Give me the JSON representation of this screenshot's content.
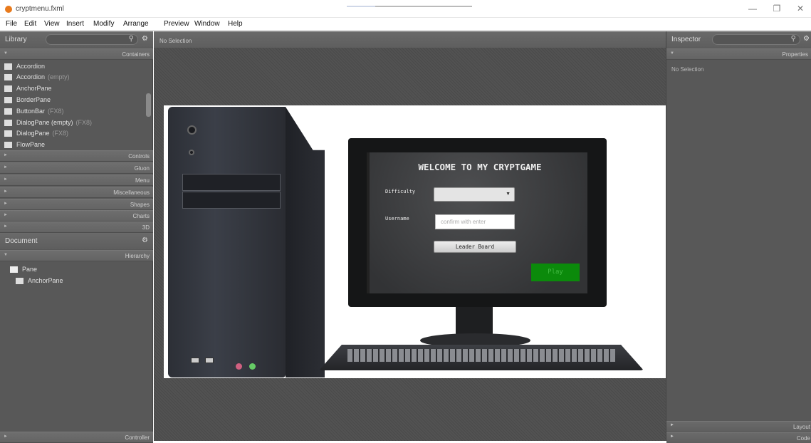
{
  "window": {
    "title": "cryptmenu.fxml",
    "minimize": "—",
    "maximize": "❐",
    "close": "✕"
  },
  "menu": [
    "File",
    "Edit",
    "View",
    "Insert",
    "Modify",
    "Arrange",
    "Preview",
    "Window",
    "Help"
  ],
  "library": {
    "title": "Library",
    "search_icon": "search-icon",
    "gear_icon": "gear-icon",
    "sections": [
      "Containers",
      "Controls",
      "Gluon",
      "Menu",
      "Miscellaneous",
      "Shapes",
      "Charts",
      "3D"
    ],
    "items": [
      {
        "name": "Accordion",
        "extra": ""
      },
      {
        "name": "Accordion",
        "extra": "(empty)"
      },
      {
        "name": "AnchorPane",
        "extra": ""
      },
      {
        "name": "BorderPane",
        "extra": ""
      },
      {
        "name": "ButtonBar",
        "extra": "(FX8)"
      },
      {
        "name": "DialogPane (empty)",
        "extra": "(FX8)"
      },
      {
        "name": "DialogPane",
        "extra": "(FX8)"
      },
      {
        "name": "FlowPane",
        "extra": ""
      }
    ]
  },
  "document": {
    "title": "Document",
    "section": "Hierarchy",
    "tree": [
      {
        "name": "Pane"
      },
      {
        "name": "AnchorPane"
      }
    ],
    "controller": "Controller"
  },
  "canvas": {
    "selection": "No Selection"
  },
  "game": {
    "title": "WELCOME TO MY CRYPTGAME",
    "difficulty_label": "Difficulty",
    "difficulty_value": "",
    "username_label": "Username",
    "username_placeholder": "confirm with enter",
    "leaderboard_label": "Leader Board",
    "play_label": "Play"
  },
  "inspector": {
    "title": "Inspector",
    "section": "Properties",
    "selection": "No Selection",
    "layout": "Layout",
    "code": "Code"
  },
  "colors": {
    "accent": "#e87a1c",
    "play": "#0b8a0b",
    "panel": "#585858"
  }
}
